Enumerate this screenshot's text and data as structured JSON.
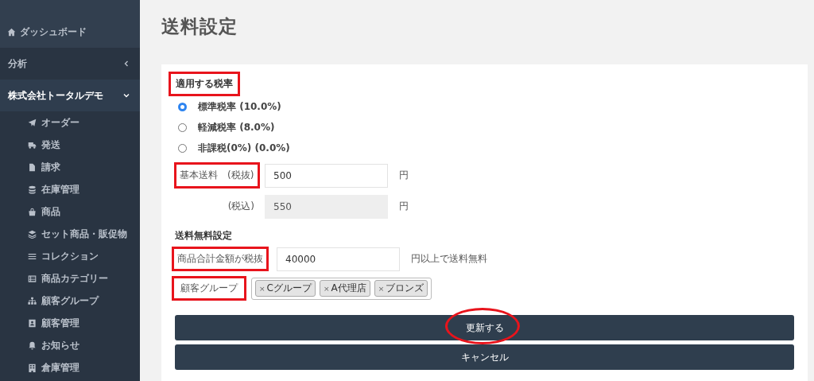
{
  "sidebar": {
    "items": [
      {
        "label": "ダッシュボード",
        "kind": "top"
      },
      {
        "label": "分析",
        "kind": "group",
        "expanded": false
      },
      {
        "label": "株式会社トータルデモ",
        "kind": "group",
        "expanded": true,
        "children": [
          {
            "label": "オーダー"
          },
          {
            "label": "発送"
          },
          {
            "label": "請求"
          },
          {
            "label": "在庫管理"
          },
          {
            "label": "商品"
          },
          {
            "label": "セット商品・販促物"
          },
          {
            "label": "コレクション"
          },
          {
            "label": "商品カテゴリー"
          },
          {
            "label": "顧客グループ"
          },
          {
            "label": "顧客管理"
          },
          {
            "label": "お知らせ"
          },
          {
            "label": "倉庫管理"
          }
        ]
      }
    ]
  },
  "page": {
    "title": "送料設定"
  },
  "tax": {
    "label": "適用する税率",
    "highlighted": true,
    "options": [
      {
        "label": "標準税率 (10.0%)",
        "selected": true
      },
      {
        "label": "軽減税率 (8.0%)",
        "selected": false
      },
      {
        "label": "非課税(0%) (0.0%)",
        "selected": false
      }
    ]
  },
  "base_fee": {
    "label": "基本送料　(税抜)",
    "highlighted": true,
    "value": "500",
    "unit": "円"
  },
  "base_fee_incl": {
    "label": "(税込)",
    "highlighted": false,
    "value": "550",
    "unit": "円",
    "disabled": true
  },
  "free_shipping": {
    "heading": "送料無料設定",
    "threshold": {
      "label": "商品合計金額が税抜",
      "highlighted": true,
      "value": "40000",
      "unit": "円以上で送料無料"
    },
    "groups": {
      "label": "顧客グループ",
      "highlighted": true,
      "tags": [
        {
          "remove": "×",
          "label": "Cグループ"
        },
        {
          "remove": "×",
          "label": "A代理店"
        },
        {
          "remove": "×",
          "label": "ブロンズ"
        }
      ]
    }
  },
  "buttons": [
    {
      "label": "更新する",
      "circled": true
    },
    {
      "label": "キャンセル",
      "circled": false
    }
  ]
}
